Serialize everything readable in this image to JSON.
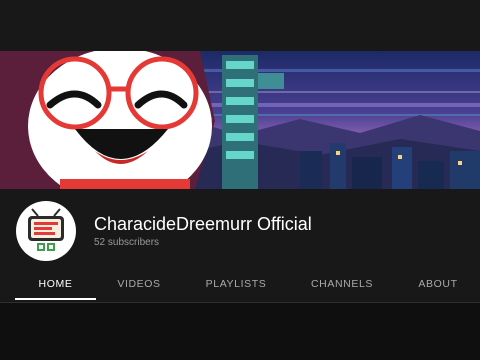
{
  "channel": {
    "name": "CharacideDreemurr Official",
    "subscribers": "52 subscribers"
  },
  "tabs": [
    {
      "label": "HOME",
      "active": true
    },
    {
      "label": "VIDEOS",
      "active": false
    },
    {
      "label": "PLAYLISTS",
      "active": false
    },
    {
      "label": "CHANNELS",
      "active": false
    },
    {
      "label": "ABOUT",
      "active": false
    }
  ],
  "colors": {
    "background": "#181818",
    "text_primary": "#ffffff",
    "text_secondary": "#aaaaaa",
    "glasses": "#e53935"
  }
}
